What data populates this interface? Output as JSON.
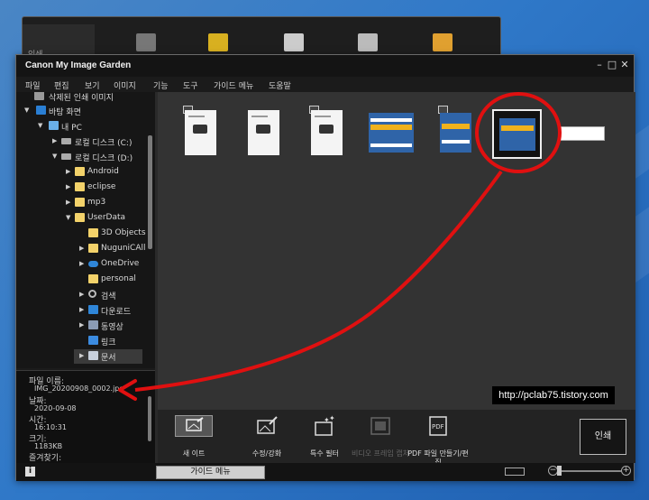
{
  "background_window": {
    "label": "인쇄"
  },
  "window": {
    "title": "Canon My Image Garden",
    "controls": [
      "minimize",
      "maximize",
      "close"
    ]
  },
  "menu": [
    "파일",
    "편집",
    "보기",
    "이미지",
    "기능",
    "도구",
    "가이드 메뉴",
    "도움말"
  ],
  "tree": {
    "items": [
      {
        "label": "삭제된 인쇄 이미지",
        "icon": "printer-icon"
      },
      {
        "label": "바탕 화면",
        "icon": "desktop-icon"
      },
      {
        "label": "내 PC",
        "icon": "pc-icon"
      },
      {
        "label": "로컬 디스크 (C:)",
        "icon": "drive-icon"
      },
      {
        "label": "로컬 디스크 (D:)",
        "icon": "drive-icon"
      },
      {
        "label": "Android",
        "icon": "folder-icon"
      },
      {
        "label": "eclipse",
        "icon": "folder-icon"
      },
      {
        "label": "mp3",
        "icon": "folder-icon"
      },
      {
        "label": "UserData",
        "icon": "folder-icon"
      },
      {
        "label": "3D Objects",
        "icon": "folder-icon"
      },
      {
        "label": "NuguniCAll",
        "icon": "folder-icon"
      },
      {
        "label": "OneDrive",
        "icon": "onedrive-icon"
      },
      {
        "label": "personal",
        "icon": "folder-icon"
      },
      {
        "label": "검색",
        "icon": "search-icon"
      },
      {
        "label": "다운로드",
        "icon": "download-icon"
      },
      {
        "label": "동영상",
        "icon": "video-icon"
      },
      {
        "label": "링크",
        "icon": "link-icon"
      },
      {
        "label": "문서",
        "icon": "document-icon"
      }
    ]
  },
  "info": {
    "filename_label": "파일 이름:",
    "filename": "IMG_20200908_0002.jpg",
    "date_label": "날짜:",
    "date": "2020-09-08",
    "time_label": "시간:",
    "time": "16:10:31",
    "size_label": "크기:",
    "size": "1183KB",
    "favorites_label": "즐겨찾기:"
  },
  "toolbar": {
    "tools": [
      {
        "label": "새 이트",
        "icon": "new-item-icon"
      },
      {
        "label": "수정/강화",
        "icon": "correct-enhance-icon"
      },
      {
        "label": "특수 필터",
        "icon": "special-filter-icon"
      },
      {
        "label": "비디오 프레임 캡처",
        "icon": "video-capture-icon"
      },
      {
        "label": "PDF 파일 만들기/편집",
        "icon": "pdf-icon"
      }
    ],
    "print_label": "인쇄"
  },
  "statusbar": {
    "guide_menu_label": "가이드 메뉴"
  },
  "watermark": "http://pclab75.tistory.com",
  "colors": {
    "annotation": "#e01010",
    "window_bg": "#1b1b1b",
    "thumb_bg": "#333333"
  }
}
